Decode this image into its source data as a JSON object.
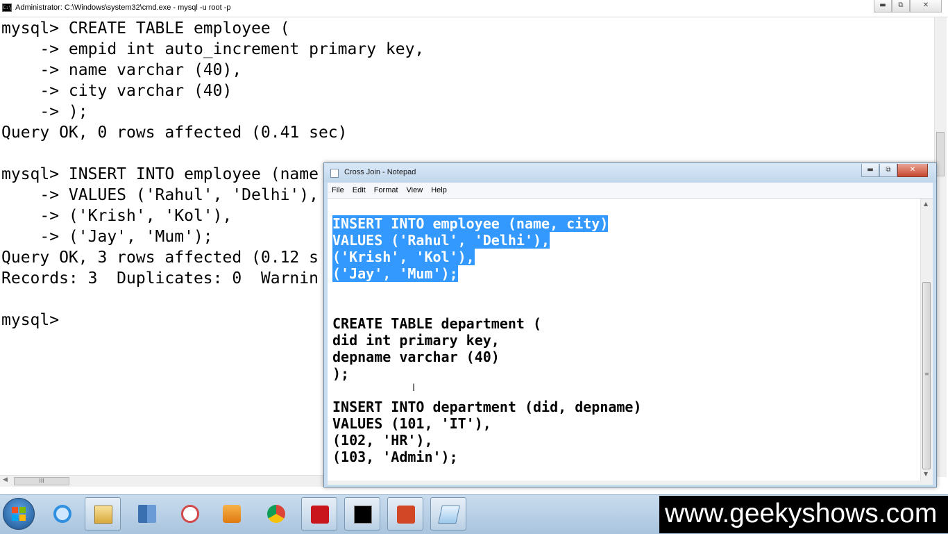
{
  "cmd": {
    "title": "Administrator: C:\\Windows\\system32\\cmd.exe - mysql  -u root -p",
    "controls": {
      "minimize": "▬",
      "restore": "⧉",
      "close": "✕"
    },
    "scrollbar_grip": "III",
    "lines": [
      "mysql> CREATE TABLE employee (",
      "    -> empid int auto_increment primary key,",
      "    -> name varchar (40),",
      "    -> city varchar (40)",
      "    -> );",
      "Query OK, 0 rows affected (0.41 sec)",
      "",
      "mysql> INSERT INTO employee (name",
      "    -> VALUES ('Rahul', 'Delhi'),",
      "    -> ('Krish', 'Kol'),",
      "    -> ('Jay', 'Mum');",
      "Query OK, 3 rows affected (0.12 s",
      "Records: 3  Duplicates: 0  Warnin",
      "",
      "mysql>"
    ]
  },
  "notepad": {
    "title": "Cross Join - Notepad",
    "controls": {
      "minimize": "▬",
      "restore": "⧉",
      "close": "✕"
    },
    "menu": [
      "File",
      "Edit",
      "Format",
      "View",
      "Help"
    ],
    "cursor_glyph": "I",
    "scroll_grip": "≡",
    "selected_lines": [
      "INSERT INTO employee (name, city)",
      "VALUES ('Rahul', 'Delhi'),",
      "('Krish', 'Kol'),",
      "('Jay', 'Mum');"
    ],
    "lines": [
      "CREATE TABLE department (",
      "did int primary key,",
      "depname varchar (40)",
      ");",
      "",
      "INSERT INTO department (did, depname)",
      "VALUES (101, 'IT'),",
      "(102, 'HR'),",
      "(103, 'Admin');"
    ]
  },
  "taskbar": {
    "apps": [
      {
        "name": "internet-explorer-icon",
        "boxed": false
      },
      {
        "name": "windows-explorer-icon",
        "boxed": true
      },
      {
        "name": "book-icon",
        "boxed": false
      },
      {
        "name": "snipping-tool-icon",
        "boxed": false
      },
      {
        "name": "media-player-icon",
        "boxed": false
      },
      {
        "name": "chrome-icon",
        "boxed": false
      },
      {
        "name": "adobe-reader-icon",
        "boxed": true
      },
      {
        "name": "command-prompt-icon",
        "boxed": true
      },
      {
        "name": "powerpoint-icon",
        "boxed": true
      },
      {
        "name": "notepad-icon",
        "boxed": true
      }
    ]
  },
  "watermark": {
    "text": "www.geekyshows.com"
  },
  "colors": {
    "selection": "#3399ff",
    "taskbar": "#b9d1e8",
    "close_button": "#c7492f"
  }
}
